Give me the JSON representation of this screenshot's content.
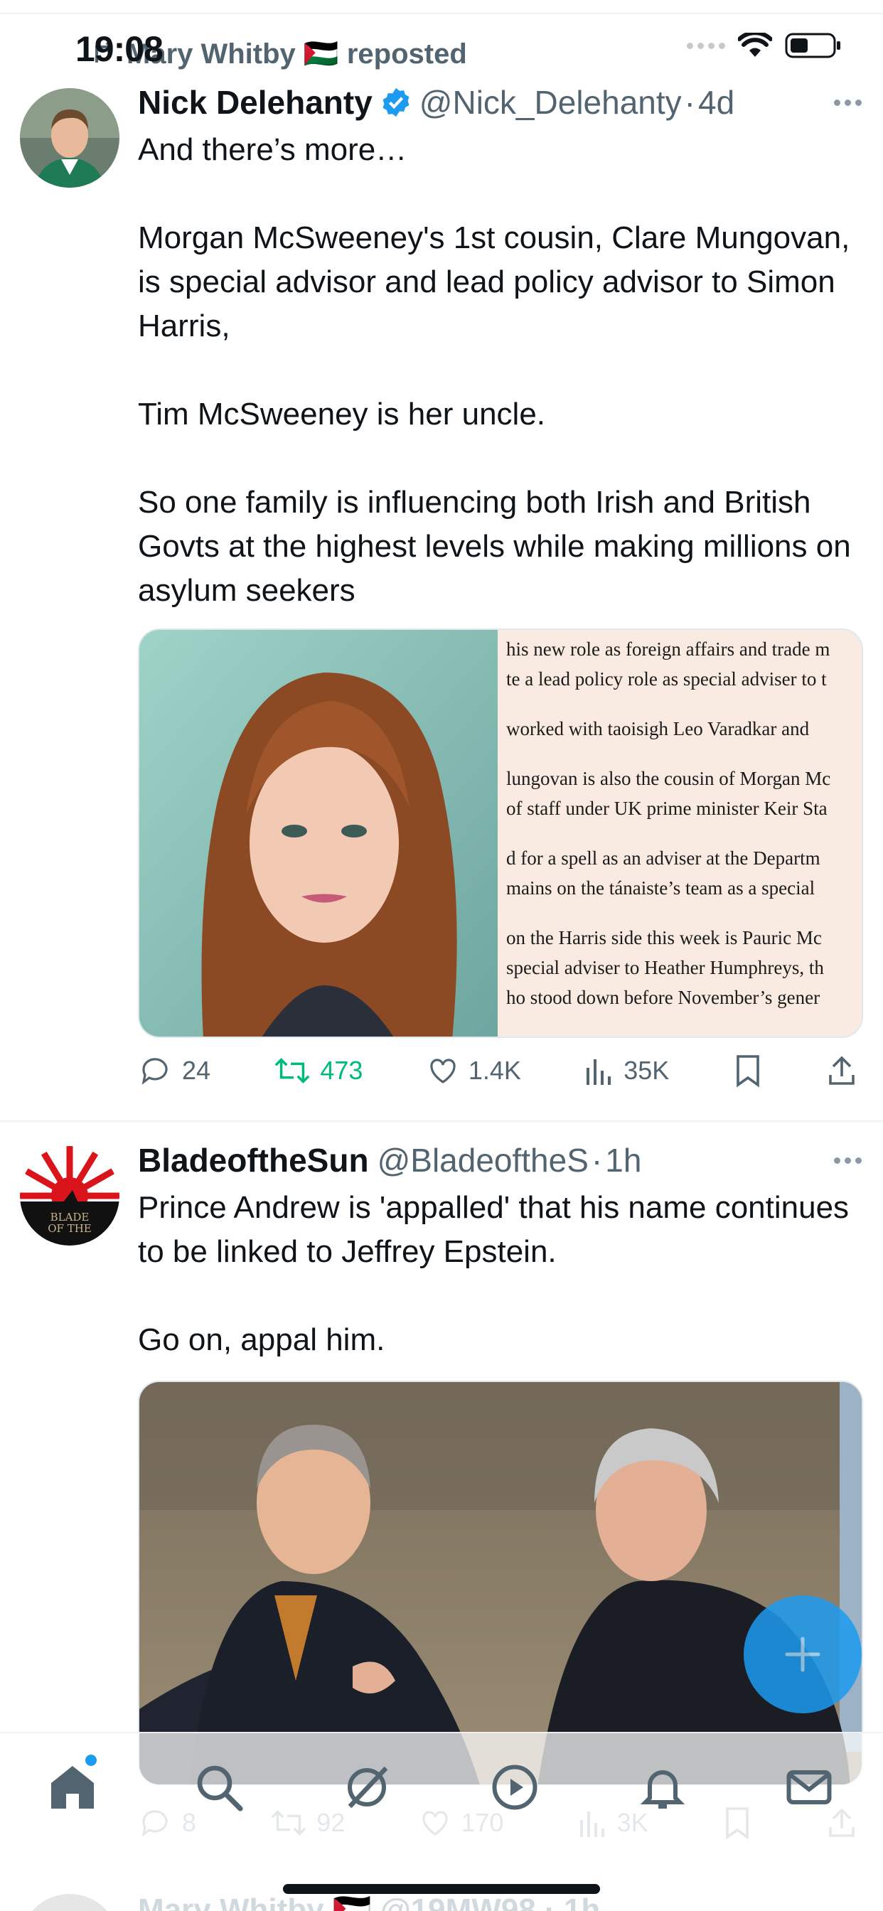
{
  "status_bar": {
    "time": "19:08"
  },
  "repost": {
    "label": "Mary Whitby 🇵🇸 reposted"
  },
  "tweets": [
    {
      "name": "Nick Delehanty",
      "handle": "@Nick_Delehanty",
      "time": "4d",
      "verified": true,
      "text": "And there’s more…\n\nMorgan McSweeney's 1st cousin, Clare Mungovan, is special advisor and lead policy advisor to Simon Harris,\n\nTim McSweeney is her uncle.\n\nSo one family is influencing both Irish and British Govts at the highest levels while making millions on asylum seekers",
      "article_lines": [
        "his new role as foreign affairs and trade m",
        "te a lead policy role as special adviser to t",
        "worked with taoisigh Leo Varadkar and",
        "lungovan is also the cousin of Morgan Mc",
        "of staff under UK prime minister Keir Sta",
        "d for a spell as an adviser at the Departm",
        "mains on the tánaiste’s team as a special",
        "on the Harris side this week is Pauric Mc",
        "special adviser to Heather Humphreys, th",
        "ho stood down before November’s gener"
      ],
      "replies": "24",
      "reposts": "473",
      "likes": "1.4K",
      "views": "35K"
    },
    {
      "name": "BladeoftheSun",
      "handle": "@BladeoftheS",
      "time": "1h",
      "verified": false,
      "avatar_text": "BLADE OF THE",
      "text": "Prince Andrew is 'appalled' that his name continues to be linked to Jeffrey Epstein.\n\nGo on, appal him.",
      "replies": "8",
      "reposts": "92",
      "likes": "170",
      "views": "3K"
    }
  ],
  "next_tweet_peek": "Mary Whitby 🇵🇸 @19MW98 · 1h",
  "colors": {
    "accent": "#1d9bf0",
    "repost_green": "#00ba7c",
    "secondary_text": "#536471"
  }
}
